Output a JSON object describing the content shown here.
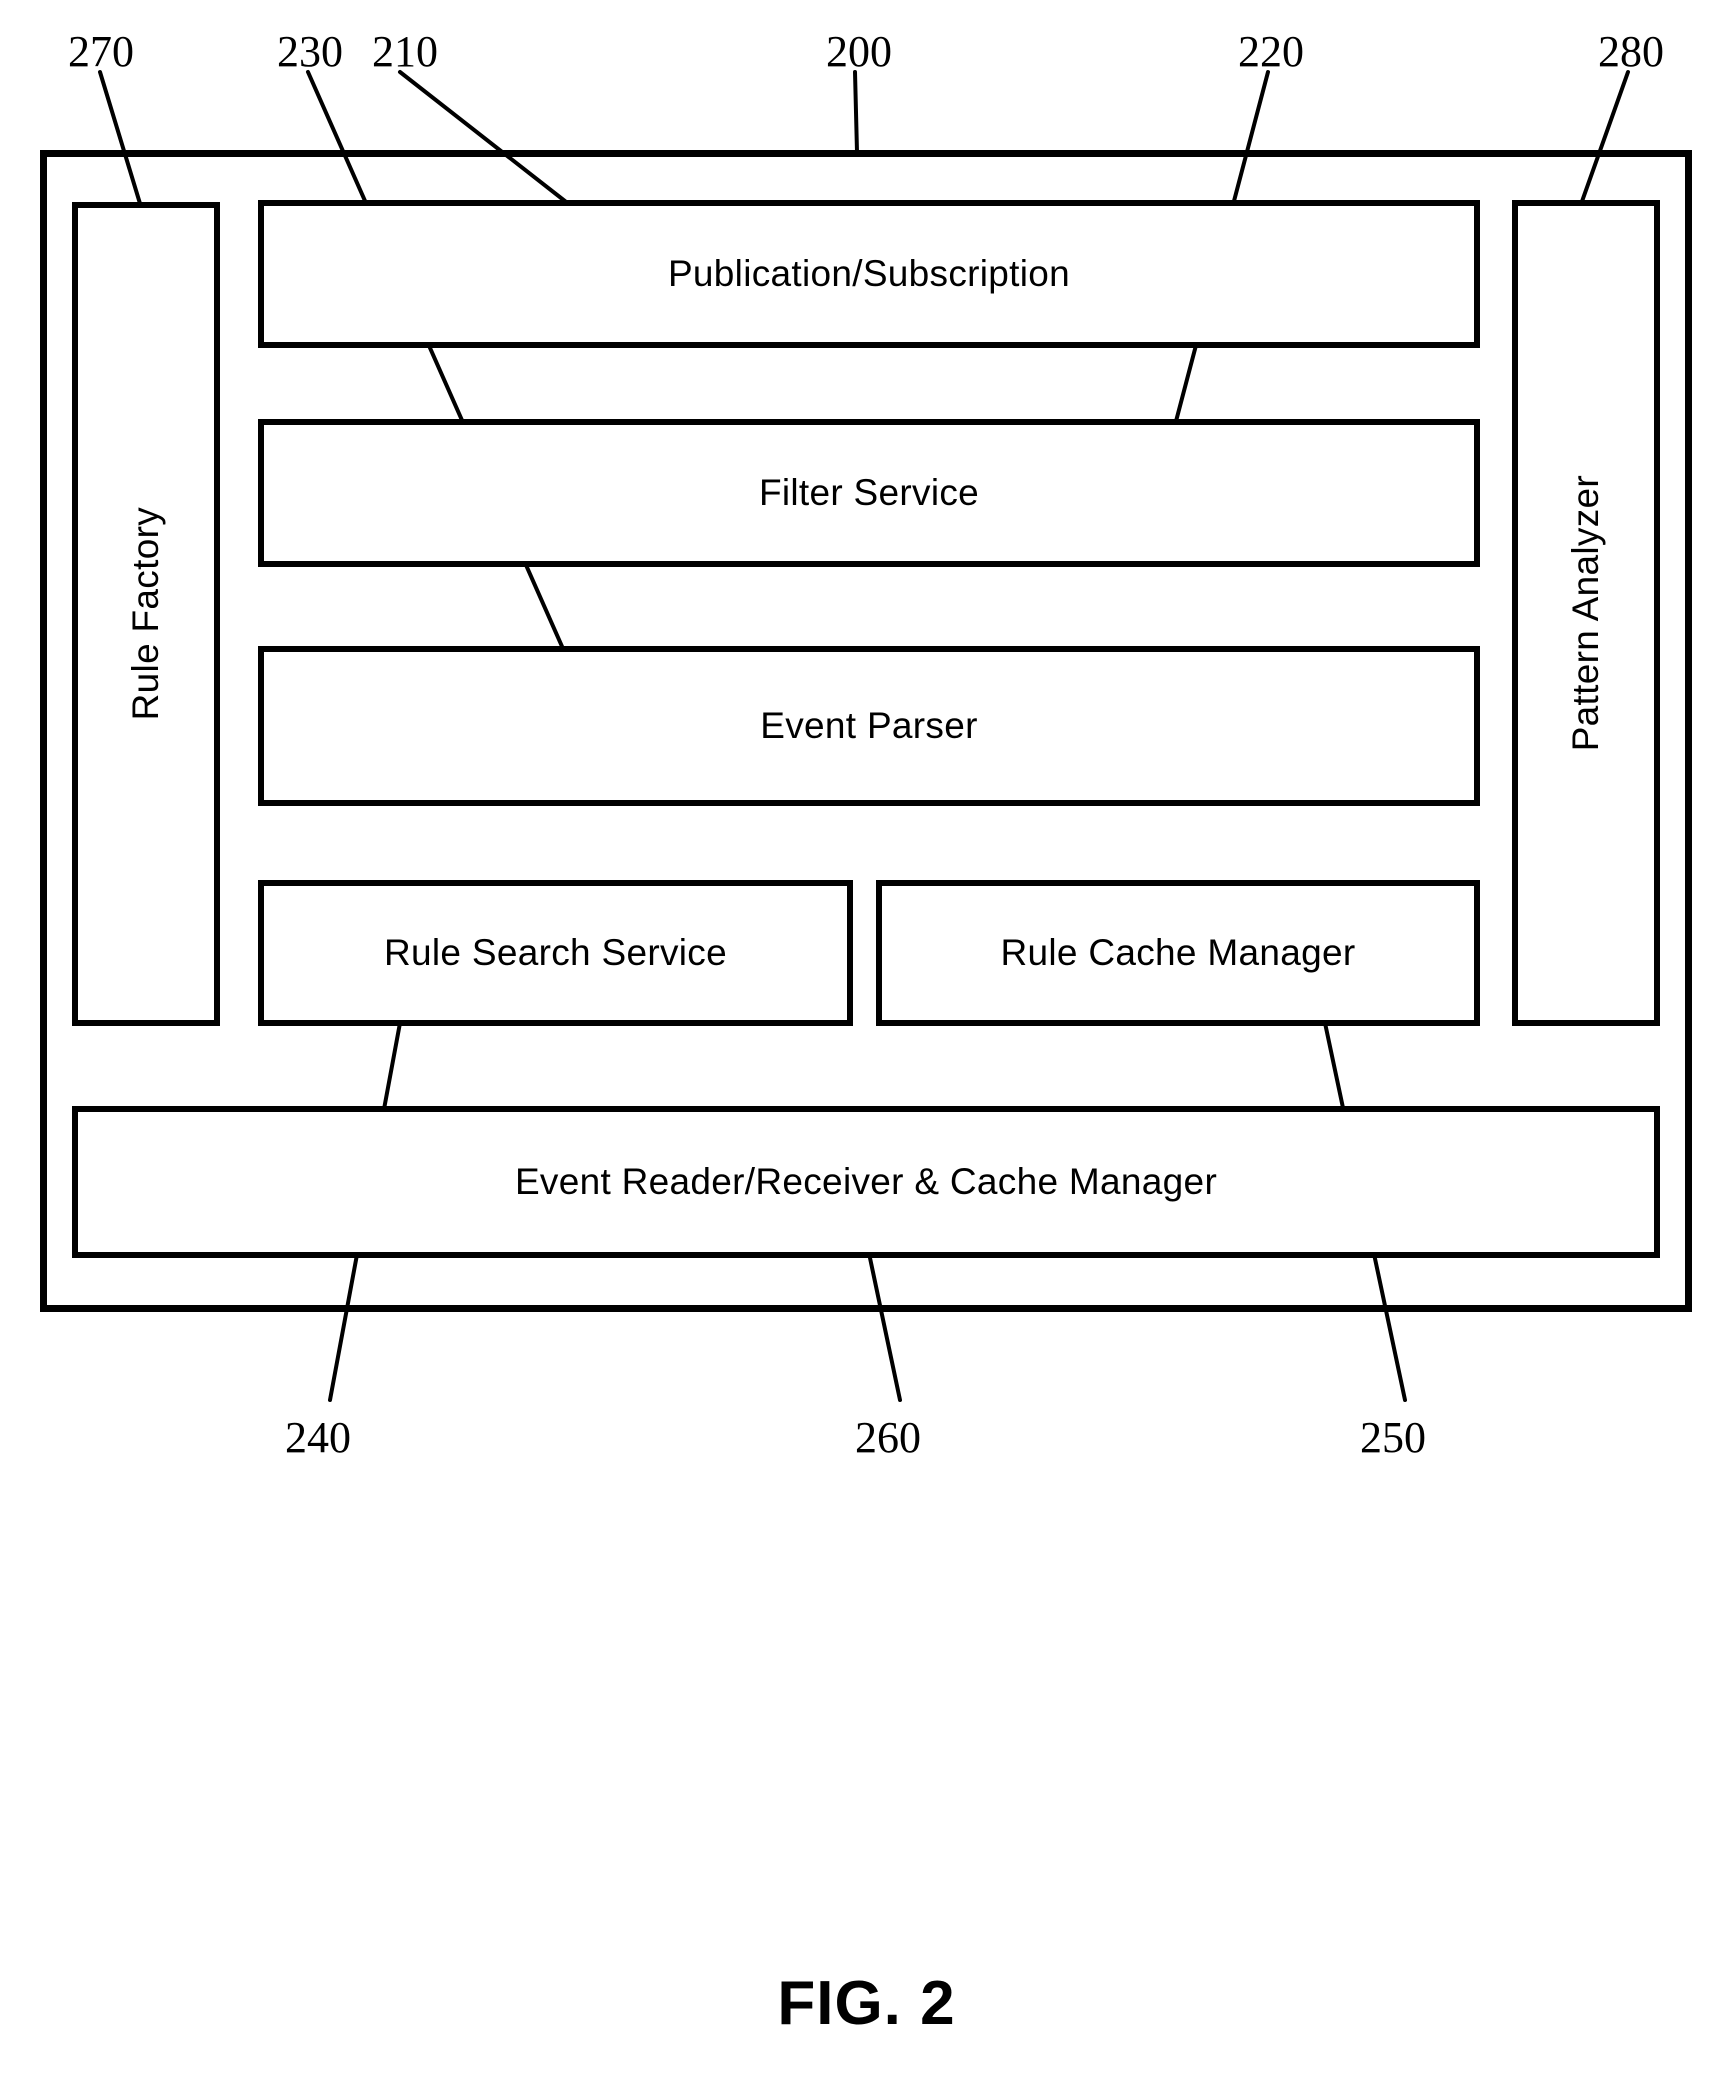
{
  "figure": {
    "caption": "FIG. 2",
    "type": "patent-block-diagram"
  },
  "diagram": {
    "outer_container": {
      "ref": "200",
      "name": "system-container"
    },
    "blocks": [
      {
        "id": "publication-subscription",
        "label": "Publication/Subscription",
        "ref": "210",
        "orientation": "horizontal"
      },
      {
        "id": "filter-service",
        "label": "Filter Service",
        "ref": "220",
        "orientation": "horizontal"
      },
      {
        "id": "event-parser",
        "label": "Event Parser",
        "ref": "230",
        "orientation": "horizontal"
      },
      {
        "id": "rule-search-service",
        "label": "Rule Search Service",
        "ref": "240",
        "orientation": "horizontal"
      },
      {
        "id": "rule-cache-manager",
        "label": "Rule Cache Manager",
        "ref": "250",
        "orientation": "horizontal"
      },
      {
        "id": "event-reader-receiver-cache-manager",
        "label": "Event Reader/Receiver & Cache Manager",
        "ref": "260",
        "orientation": "horizontal"
      },
      {
        "id": "rule-factory",
        "label": "Rule Factory",
        "ref": "270",
        "orientation": "vertical"
      },
      {
        "id": "pattern-analyzer",
        "label": "Pattern Analyzer",
        "ref": "280",
        "orientation": "vertical"
      }
    ],
    "reference_numerals": {
      "top": [
        "270",
        "230",
        "210",
        "200",
        "220",
        "280"
      ],
      "bottom": [
        "240",
        "260",
        "250"
      ],
      "r270": "270",
      "r230": "230",
      "r210": "210",
      "r200": "200",
      "r220": "220",
      "r280": "280",
      "r240": "240",
      "r260": "260",
      "r250": "250"
    },
    "colors": {
      "line": "#000000",
      "fill": "#ffffff"
    }
  }
}
